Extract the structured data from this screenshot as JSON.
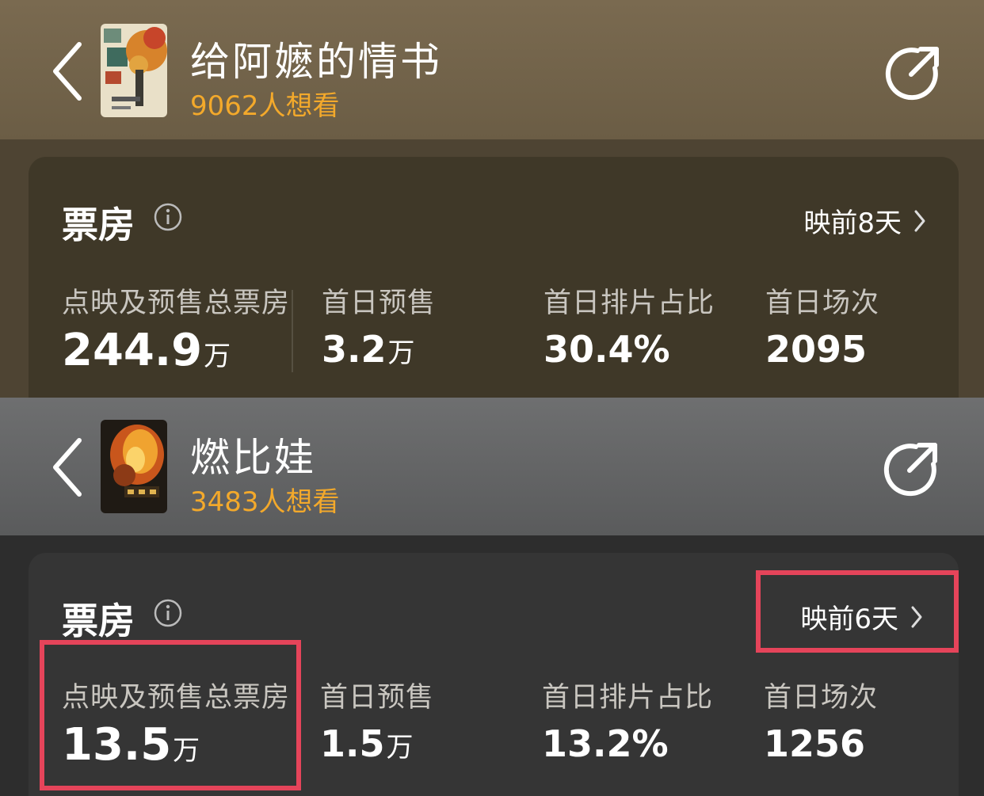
{
  "movies": [
    {
      "title": "给阿嬷的情书",
      "want": "9062人想看",
      "card_title": "票房",
      "pre_release": "映前8天",
      "stats": [
        {
          "label": "点映及预售总票房",
          "value": "244.9",
          "unit": "万"
        },
        {
          "label": "首日预售",
          "value": "3.2",
          "unit": "万"
        },
        {
          "label": "首日排片占比",
          "value": "30.4%",
          "unit": ""
        },
        {
          "label": "首日场次",
          "value": "2095",
          "unit": ""
        }
      ]
    },
    {
      "title": "燃比娃",
      "want": "3483人想看",
      "card_title": "票房",
      "pre_release": "映前6天",
      "stats": [
        {
          "label": "点映及预售总票房",
          "value": "13.5",
          "unit": "万"
        },
        {
          "label": "首日预售",
          "value": "1.5",
          "unit": "万"
        },
        {
          "label": "首日排片占比",
          "value": "13.2%",
          "unit": ""
        },
        {
          "label": "首日场次",
          "value": "1256",
          "unit": ""
        }
      ]
    }
  ],
  "colors": {
    "want_orange": "#f3a92b",
    "highlight_red": "#e5445a"
  },
  "icons": [
    "back-arrow-icon",
    "share-icon",
    "info-icon",
    "chevron-right-icon"
  ]
}
